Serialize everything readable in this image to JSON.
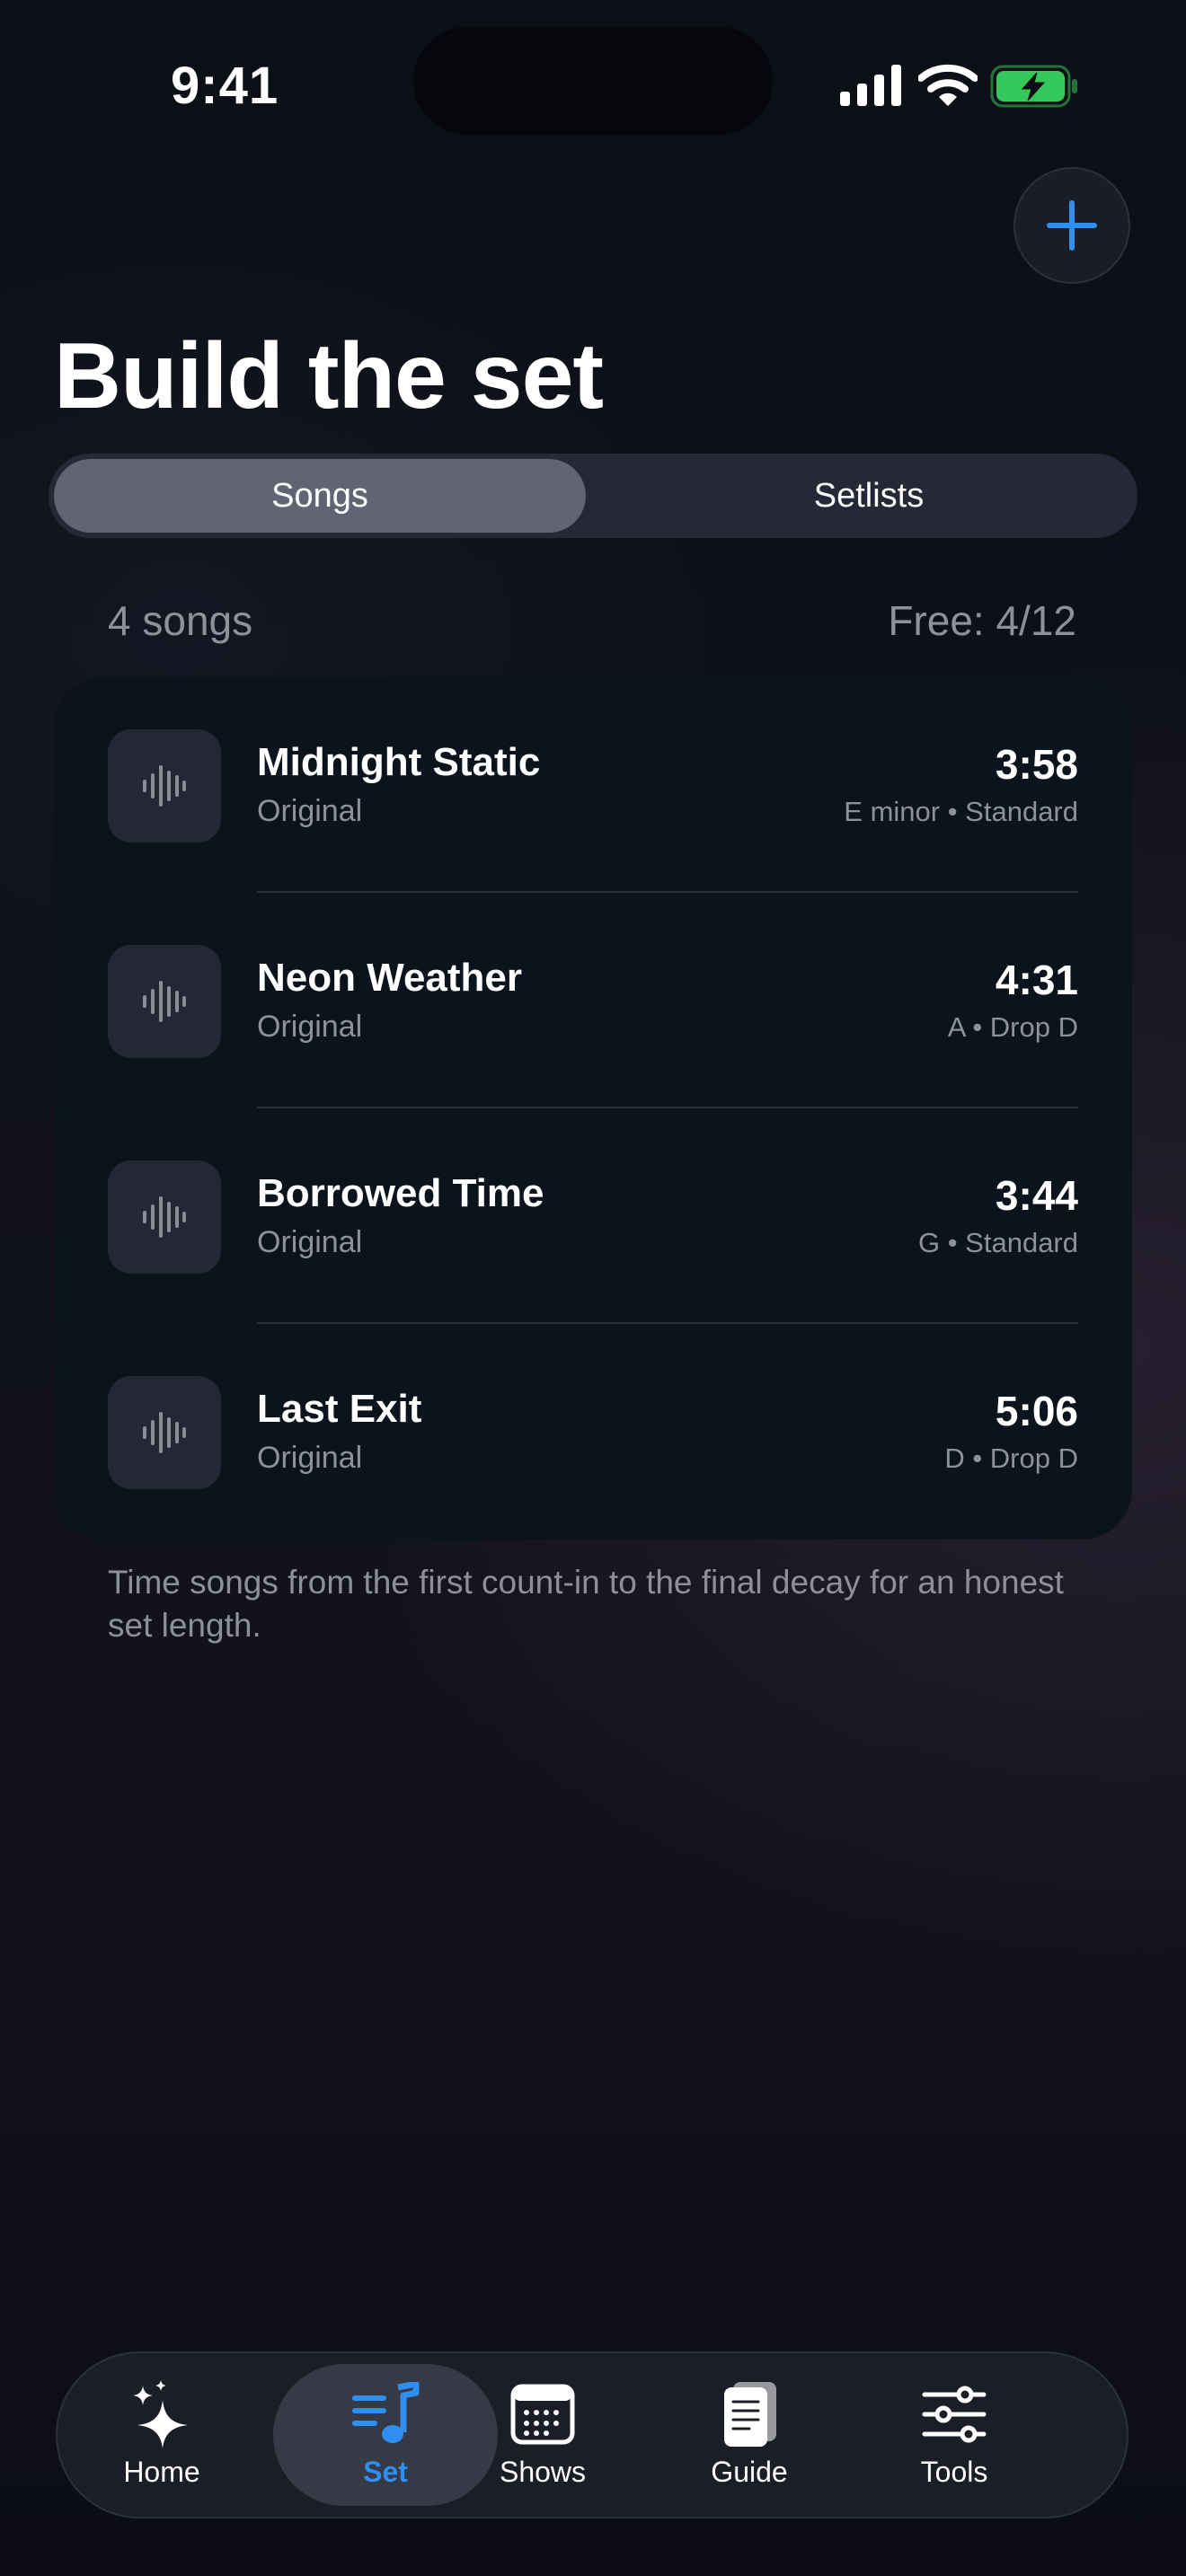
{
  "status_bar": {
    "time": "9:41"
  },
  "header": {
    "title": "Build the set",
    "add_icon": "plus-icon"
  },
  "segmented": {
    "options": [
      "Songs",
      "Setlists"
    ],
    "selected": "Songs"
  },
  "summary": {
    "count": "4 songs",
    "free": "Free: 4/12"
  },
  "songs": [
    {
      "title": "Midnight Static",
      "subtitle": "Original",
      "duration": "3:58",
      "meta": "E minor • Standard"
    },
    {
      "title": "Neon Weather",
      "subtitle": "Original",
      "duration": "4:31",
      "meta": "A • Drop D"
    },
    {
      "title": "Borrowed Time",
      "subtitle": "Original",
      "duration": "3:44",
      "meta": "G • Standard"
    },
    {
      "title": "Last Exit",
      "subtitle": "Original",
      "duration": "5:06",
      "meta": "D • Drop D"
    }
  ],
  "footnote": "Time songs from the first count-in to the final decay for an honest set length.",
  "tabbar": {
    "active": "Set",
    "tabs": [
      {
        "label": "Home",
        "icon": "sparkles-icon"
      },
      {
        "label": "Set",
        "icon": "music-list-icon"
      },
      {
        "label": "Shows",
        "icon": "calendar-icon"
      },
      {
        "label": "Guide",
        "icon": "book-icon"
      },
      {
        "label": "Tools",
        "icon": "sliders-icon"
      }
    ]
  },
  "colors": {
    "accent": "#2f8ff0",
    "battery": "#34c759",
    "background": "#0d0f17",
    "card": "#0b131d"
  }
}
